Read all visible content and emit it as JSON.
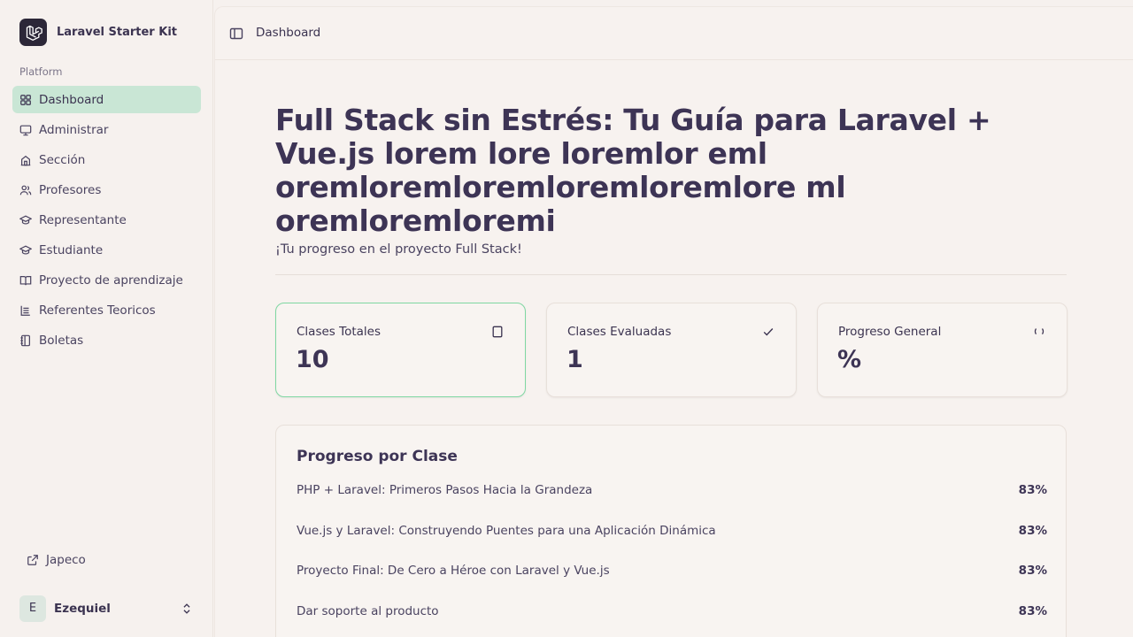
{
  "brand": {
    "name": "Laravel Starter Kit",
    "icon": "laravel-logo-icon"
  },
  "sidebar": {
    "group_label": "Platform",
    "items": [
      {
        "label": "Dashboard",
        "icon": "grid-icon",
        "active": true
      },
      {
        "label": "Administrar",
        "icon": "monitor-icon"
      },
      {
        "label": "Sección",
        "icon": "building-icon"
      },
      {
        "label": "Profesores",
        "icon": "users-icon"
      },
      {
        "label": "Representante",
        "icon": "graduation-cap-icon"
      },
      {
        "label": "Estudiante",
        "icon": "graduation-cap-icon"
      },
      {
        "label": "Proyecto de aprendizaje",
        "icon": "book-open-icon"
      },
      {
        "label": "Referentes Teoricos",
        "icon": "list-icon"
      },
      {
        "label": "Boletas",
        "icon": "notebook-icon"
      }
    ],
    "footer_link": {
      "label": "Japeco",
      "icon": "external-link-icon"
    },
    "user": {
      "initial": "E",
      "name": "Ezequiel"
    }
  },
  "topbar": {
    "breadcrumb": "Dashboard"
  },
  "hero": {
    "title": "Full Stack sin Estrés: Tu Guía para Laravel + Vue.js lorem lore loremlor eml oremloremloremloremloremlore ml oremloremloremi",
    "subtitle": "¡Tu progreso en el proyecto Full Stack!"
  },
  "cards": [
    {
      "label": "Clases Totales",
      "value": "10",
      "icon": "square-icon"
    },
    {
      "label": "Clases Evaluadas",
      "value": "1",
      "icon": "check-icon"
    },
    {
      "label": "Progreso General",
      "value": "%",
      "icon": "loader-icon"
    }
  ],
  "progress": {
    "title": "Progreso por Clase",
    "rows": [
      {
        "name": "PHP + Laravel: Primeros Pasos Hacia la Grandeza",
        "pct": "83%"
      },
      {
        "name": "Vue.js y Laravel: Construyendo Puentes para una Aplicación Dinámica",
        "pct": "83%"
      },
      {
        "name": "Proyecto Final: De Cero a Héroe con Laravel y Vue.js",
        "pct": "83%"
      },
      {
        "name": "Dar soporte al producto",
        "pct": "83%"
      }
    ]
  },
  "colors": {
    "active_nav": "#c9e6d5",
    "card_highlight": "#7fd7a2",
    "text": "#3d3455"
  }
}
